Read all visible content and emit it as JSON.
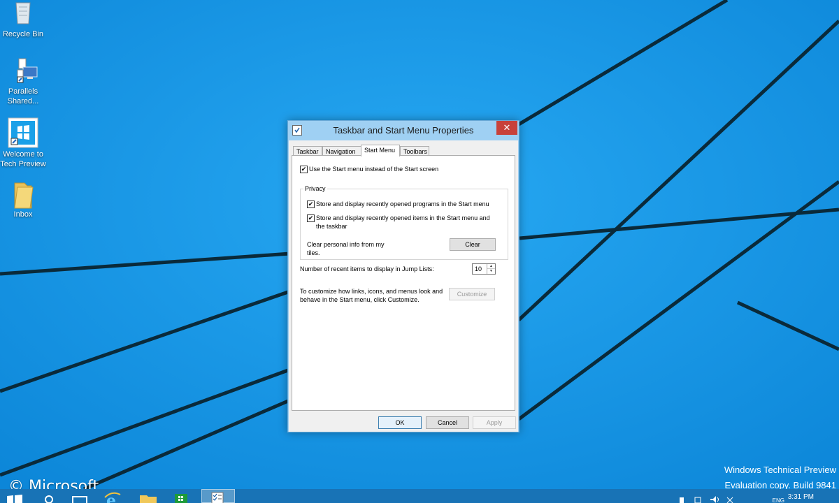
{
  "desktop": {
    "icons": [
      {
        "label": "Recycle Bin",
        "icon": "recycle-bin-icon"
      },
      {
        "label": "Parallels Shared...",
        "icon": "parallels-shared-icon"
      },
      {
        "label": "Welcome to Tech Preview",
        "icon": "windows-logo-icon"
      },
      {
        "label": "Inbox",
        "icon": "folder-icon"
      }
    ],
    "watermark": "© Microsoft",
    "eval_line1": "Windows Technical Preview",
    "eval_line2": "Evaluation copy. Build 9841",
    "accent": "#1697e6"
  },
  "taskbar": {
    "buttons": [
      "start-button",
      "search-button",
      "task-view-button",
      "internet-explorer",
      "file-explorer",
      "store",
      "taskbar-properties"
    ],
    "language": "ENG",
    "clock": "3:31 PM",
    "color": "#1873b6"
  },
  "dialog": {
    "title": "Taskbar and Start Menu Properties",
    "close_glyph": "✕",
    "tabs": [
      "Taskbar",
      "Navigation",
      "Start Menu",
      "Toolbars"
    ],
    "active_tab": "Start Menu",
    "use_start_menu": {
      "label": "Use the Start menu instead of the Start screen",
      "checked": true
    },
    "privacy": {
      "legend": "Privacy",
      "store_programs": {
        "label": "Store and display recently opened programs in the Start menu",
        "checked": true
      },
      "store_items": {
        "label_line1": "Store and display recently opened items in the Start menu and",
        "label_line2": "the taskbar",
        "checked": true
      },
      "clear_text_line1": "Clear personal info from my",
      "clear_text_line2": "tiles.",
      "clear_button": "Clear"
    },
    "jump_lists": {
      "label": "Number of recent items to display in Jump Lists:",
      "value": "10"
    },
    "customize": {
      "text_line1": "To customize how links, icons, and menus look and",
      "text_line2": "behave in the Start menu, click Customize.",
      "button": "Customize"
    },
    "buttons": {
      "ok": "OK",
      "cancel": "Cancel",
      "apply": "Apply"
    }
  }
}
